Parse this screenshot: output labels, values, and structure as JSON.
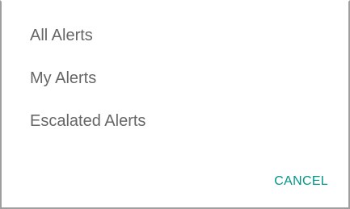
{
  "dialog": {
    "options": [
      {
        "label": "All Alerts"
      },
      {
        "label": "My Alerts"
      },
      {
        "label": "Escalated Alerts"
      }
    ],
    "cancel_label": "CANCEL"
  },
  "colors": {
    "option_text": "#666666",
    "accent": "#009688",
    "border": "#9e9e9e"
  }
}
